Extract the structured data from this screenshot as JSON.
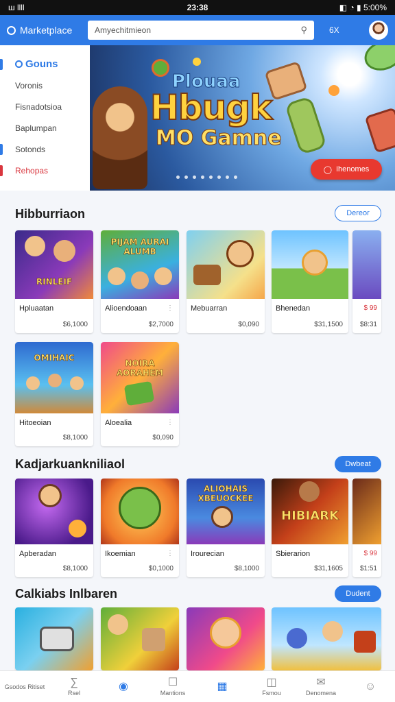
{
  "status_bar": {
    "time": "23:38",
    "left": "ш llll",
    "right": "◧ ◔ ▮ 5:00%"
  },
  "app_bar": {
    "title": "Marketplace",
    "search_value": "Amyechitmieon",
    "menu_label": "6X"
  },
  "sidebar": {
    "items": [
      {
        "label": "Gouns",
        "active": true
      },
      {
        "label": "Voronis"
      },
      {
        "label": "Fisnadotsioa"
      },
      {
        "label": "Baplumpan"
      },
      {
        "label": "Sotonds"
      },
      {
        "label": "Rehopas",
        "hot": true
      }
    ]
  },
  "banner": {
    "title_small": "Plouaa",
    "title_big": "Hbugk",
    "title_sub": "MO Gamne",
    "cta": "Ihenomes",
    "slide_count": 8
  },
  "sections": [
    {
      "title": "Hibburriaon",
      "more": "Dereor",
      "cards": [
        {
          "name": "Hpluaatan",
          "price": "$6,1000",
          "thumb_text": "RINLEIF"
        },
        {
          "name": "Alioendoaan",
          "price": "$2,7000",
          "thumb_text": "PIJAM AURAI ALUMB"
        },
        {
          "name": "Mebuarran",
          "price": "$0,090",
          "thumb_text": ""
        },
        {
          "name": "Bhenedan",
          "price": "$31,1500",
          "tag": "$ 99",
          "price2": "$8:31",
          "thumb_text": ""
        },
        {
          "name": "Hitoeoian",
          "price": "$8,1000",
          "thumb_text": "OMIHAIC"
        },
        {
          "name": "Aloealia",
          "price": "$0,090",
          "thumb_text": "NOIRA AORAHEM"
        }
      ]
    },
    {
      "title": "Kadjarkuankniliaol",
      "more": "Dwbeat",
      "cards": [
        {
          "name": "Apberadan",
          "price": "$8,1000",
          "thumb_text": ""
        },
        {
          "name": "Ikoemian",
          "price": "$0,1000",
          "thumb_text": ""
        },
        {
          "name": "Irourecian",
          "price": "$8,1000",
          "thumb_text": "ALIOHAIS XBEUOCKEE"
        },
        {
          "name": "Sbierarion",
          "price": "$31,1605",
          "tag": "$ 99",
          "price2": "$1:51",
          "thumb_text": "HIBIARK"
        }
      ]
    },
    {
      "title": "Calkiabs Inlbaren",
      "more": "Dudent",
      "cards": [
        {
          "name": "",
          "price": ""
        },
        {
          "name": "",
          "price": ""
        },
        {
          "name": "",
          "price": ""
        },
        {
          "name": "",
          "price": ""
        }
      ]
    }
  ],
  "bottom_nav": [
    {
      "label": "Gsodos Ritiset",
      "icon": "home-icon"
    },
    {
      "label": "Rsel",
      "icon": "tag-icon"
    },
    {
      "label": "",
      "icon": "controller-icon",
      "active": true
    },
    {
      "label": "Mantions",
      "icon": "chat-icon"
    },
    {
      "label": "",
      "icon": "store-icon",
      "active": true
    },
    {
      "label": "Fsmou",
      "icon": "gift-icon"
    },
    {
      "label": "Denomena",
      "icon": "mail-icon"
    },
    {
      "label": "",
      "icon": "profile-icon"
    }
  ],
  "colors": {
    "primary": "#2f7be6",
    "accent": "#e8392f",
    "background": "#f4f6fa"
  }
}
